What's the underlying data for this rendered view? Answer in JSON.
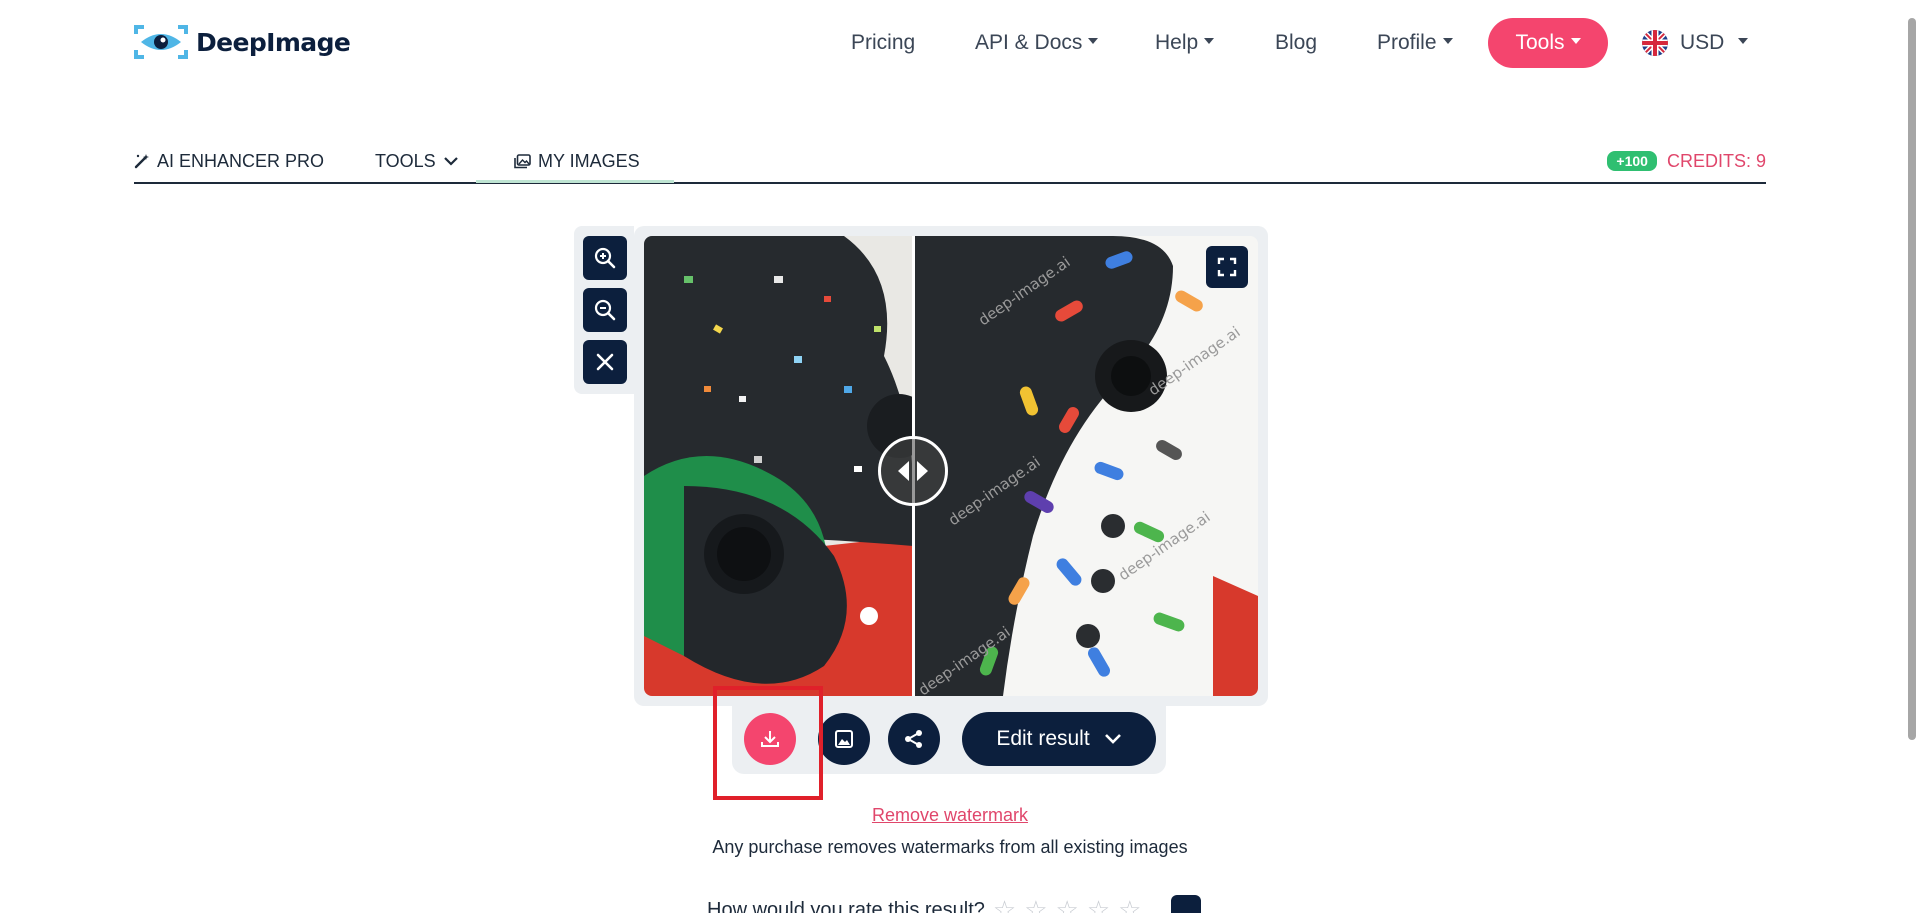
{
  "brand": {
    "name": "DeepImage",
    "accent": "#f4456e",
    "navy": "#0c1f3d"
  },
  "nav": {
    "pricing": "Pricing",
    "api_docs": "API & Docs",
    "help": "Help",
    "blog": "Blog",
    "profile": "Profile",
    "tools": "Tools",
    "currency": "USD"
  },
  "tabs": {
    "enhancer": "AI ENHANCER PRO",
    "tools": "TOOLS",
    "my_images": "MY IMAGES"
  },
  "credits": {
    "bonus": "+100",
    "label": "CREDITS: 9"
  },
  "viewer": {
    "zoom_in_icon": "zoom-in-icon",
    "zoom_out_icon": "zoom-out-icon",
    "close_icon": "close-icon",
    "fullscreen_icon": "fullscreen-icon",
    "watermark": "deep-image.ai"
  },
  "actions": {
    "download_icon": "download-icon",
    "gallery_icon": "image-icon",
    "share_icon": "share-icon",
    "edit_label": "Edit result"
  },
  "footer": {
    "remove_watermark": "Remove watermark",
    "purchase_note": "Any purchase removes watermarks from all existing images",
    "rate_question": "How would you rate this result?",
    "stars": [
      "☆",
      "☆",
      "☆",
      "☆",
      "☆"
    ]
  }
}
